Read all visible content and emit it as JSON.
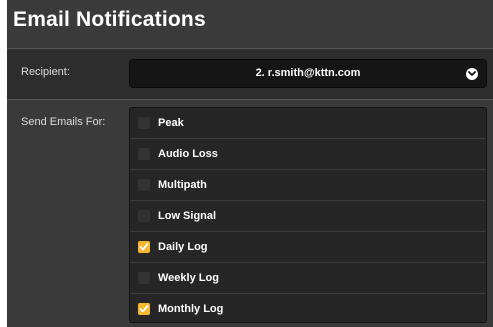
{
  "header": {
    "title": "Email Notifications"
  },
  "recipient": {
    "label": "Recipient:",
    "selected": "2. r.smith@kttn.com",
    "chevron_icon": "chevron-down-circle-icon"
  },
  "send_emails": {
    "label": "Send Emails For:",
    "options": [
      {
        "label": "Peak",
        "checked": false
      },
      {
        "label": "Audio Loss",
        "checked": false
      },
      {
        "label": "Multipath",
        "checked": false
      },
      {
        "label": "Low Signal",
        "checked": false
      },
      {
        "label": "Daily Log",
        "checked": true
      },
      {
        "label": "Weekly Log",
        "checked": false
      },
      {
        "label": "Monthly Log",
        "checked": true
      }
    ]
  },
  "colors": {
    "panel_background": "#3a3a3a",
    "checked_accent": "#f5b82e",
    "select_background": "#151515"
  }
}
